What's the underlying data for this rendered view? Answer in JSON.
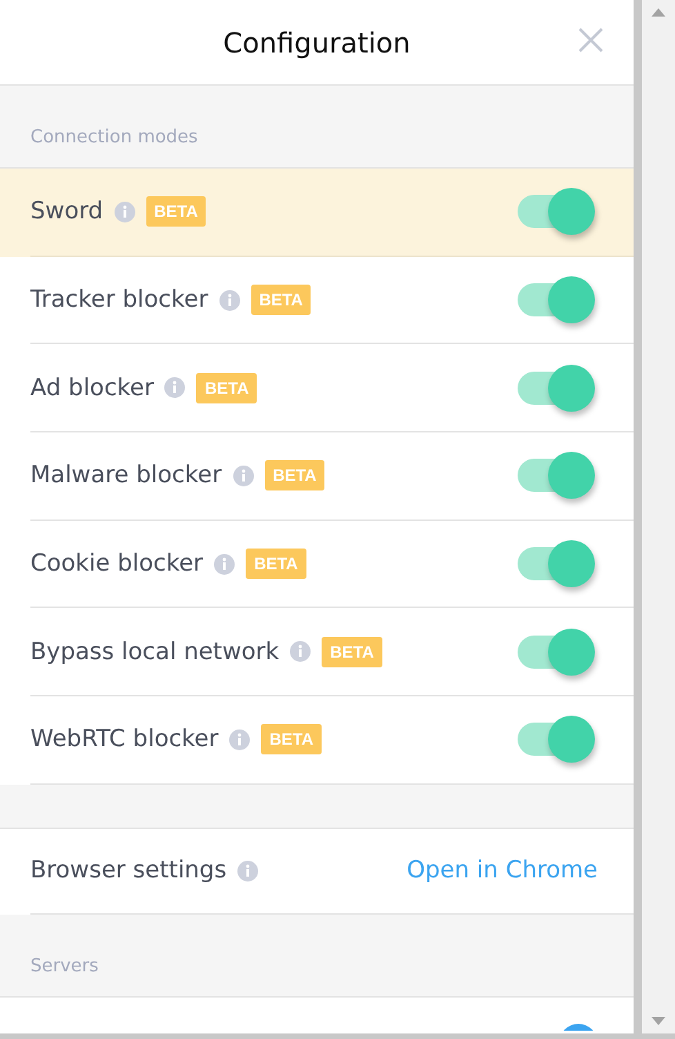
{
  "header": {
    "title": "Configuration"
  },
  "connection_modes": {
    "heading": "Connection modes",
    "items": [
      {
        "label": "Sword",
        "badge": "BETA",
        "selected": true,
        "on": true
      },
      {
        "label": "Tracker blocker",
        "badge": "BETA",
        "selected": false,
        "on": true
      },
      {
        "label": "Ad blocker",
        "badge": "BETA",
        "selected": false,
        "on": true
      },
      {
        "label": "Malware blocker",
        "badge": "BETA",
        "selected": false,
        "on": true
      },
      {
        "label": "Cookie blocker",
        "badge": "BETA",
        "selected": false,
        "on": true
      },
      {
        "label": "Bypass local network",
        "badge": "BETA",
        "selected": false,
        "on": true
      },
      {
        "label": "WebRTC blocker",
        "badge": "BETA",
        "selected": false,
        "on": true
      }
    ]
  },
  "browser_settings": {
    "label": "Browser settings",
    "link": "Open in Chrome"
  },
  "servers": {
    "heading": "Servers"
  }
}
